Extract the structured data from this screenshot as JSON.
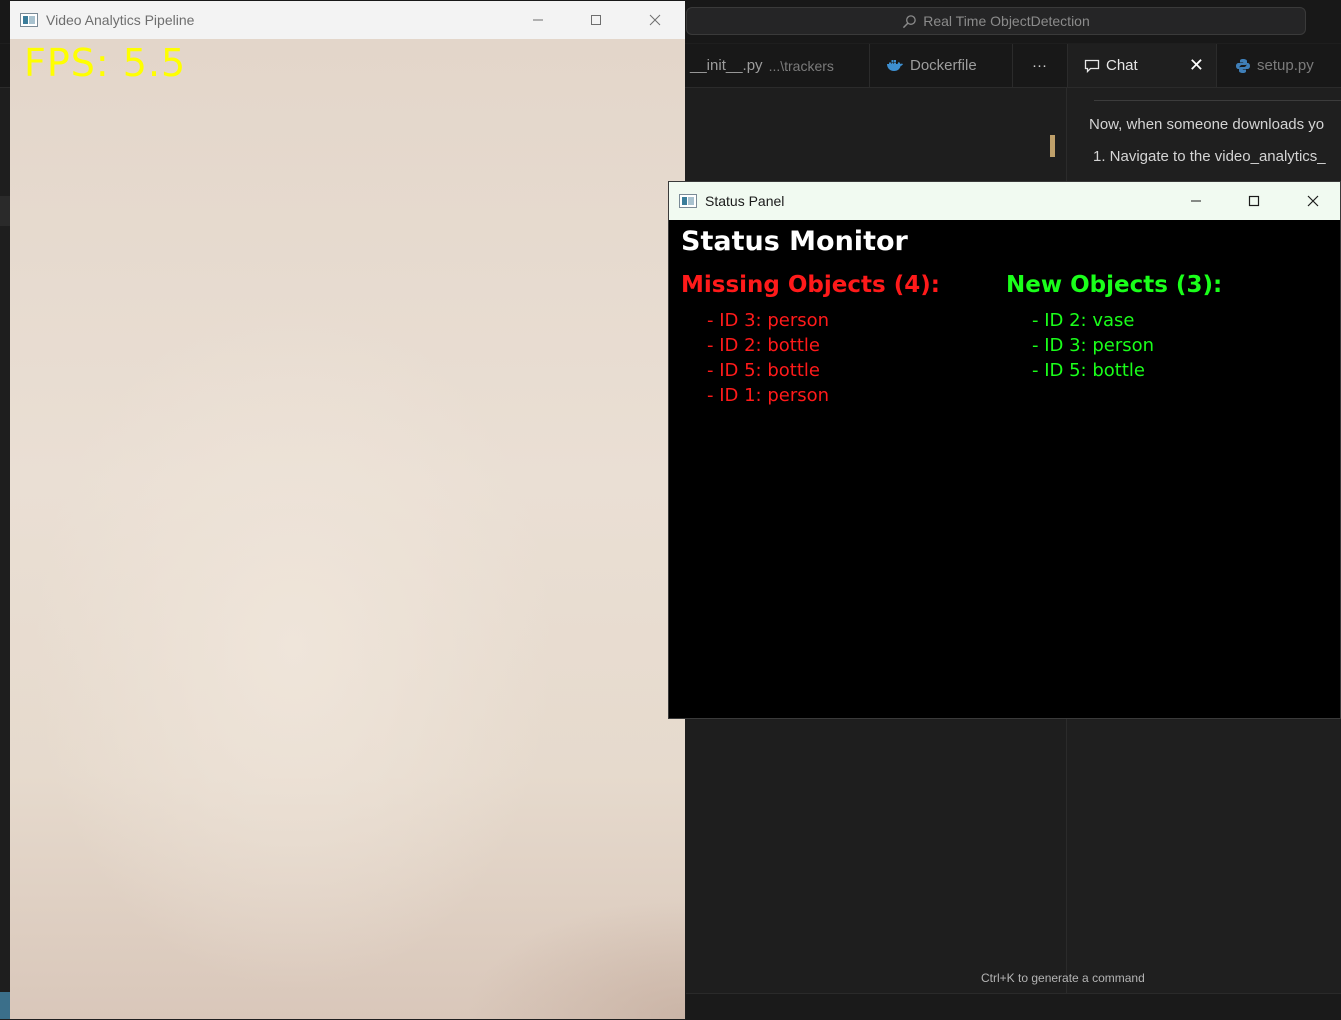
{
  "ide": {
    "search_text": "Real Time ObjectDetection",
    "tabs": [
      {
        "label": "__init__.py",
        "detail": "...\\trackers"
      },
      {
        "label": "Dockerfile"
      },
      {
        "label": "···"
      },
      {
        "label": "Chat"
      },
      {
        "label": "setup.py"
      }
    ],
    "chat_lines": [
      "Now, when someone downloads yo",
      "1. Navigate to the video_analytics_"
    ],
    "hint": "Ctrl+K to generate a command",
    "colors": {
      "background": "#1e1e1e",
      "cursor": "#bfa06a"
    }
  },
  "video_window": {
    "title": "Video Analytics Pipeline",
    "fps_text": "FPS: 5.5",
    "fps_color": "#ffff00"
  },
  "status_window": {
    "title": "Status Panel",
    "heading": "Status Monitor",
    "missing": {
      "heading": "Missing Objects (4):",
      "color": "#ff1a1a",
      "items": [
        "- ID 3: person",
        "- ID 2: bottle",
        "- ID 5: bottle",
        "- ID 1: person"
      ]
    },
    "new": {
      "heading": "New Objects (3):",
      "color": "#1aff1a",
      "items": [
        "- ID 2: vase",
        "- ID 3: person",
        "- ID 5: bottle"
      ]
    }
  }
}
